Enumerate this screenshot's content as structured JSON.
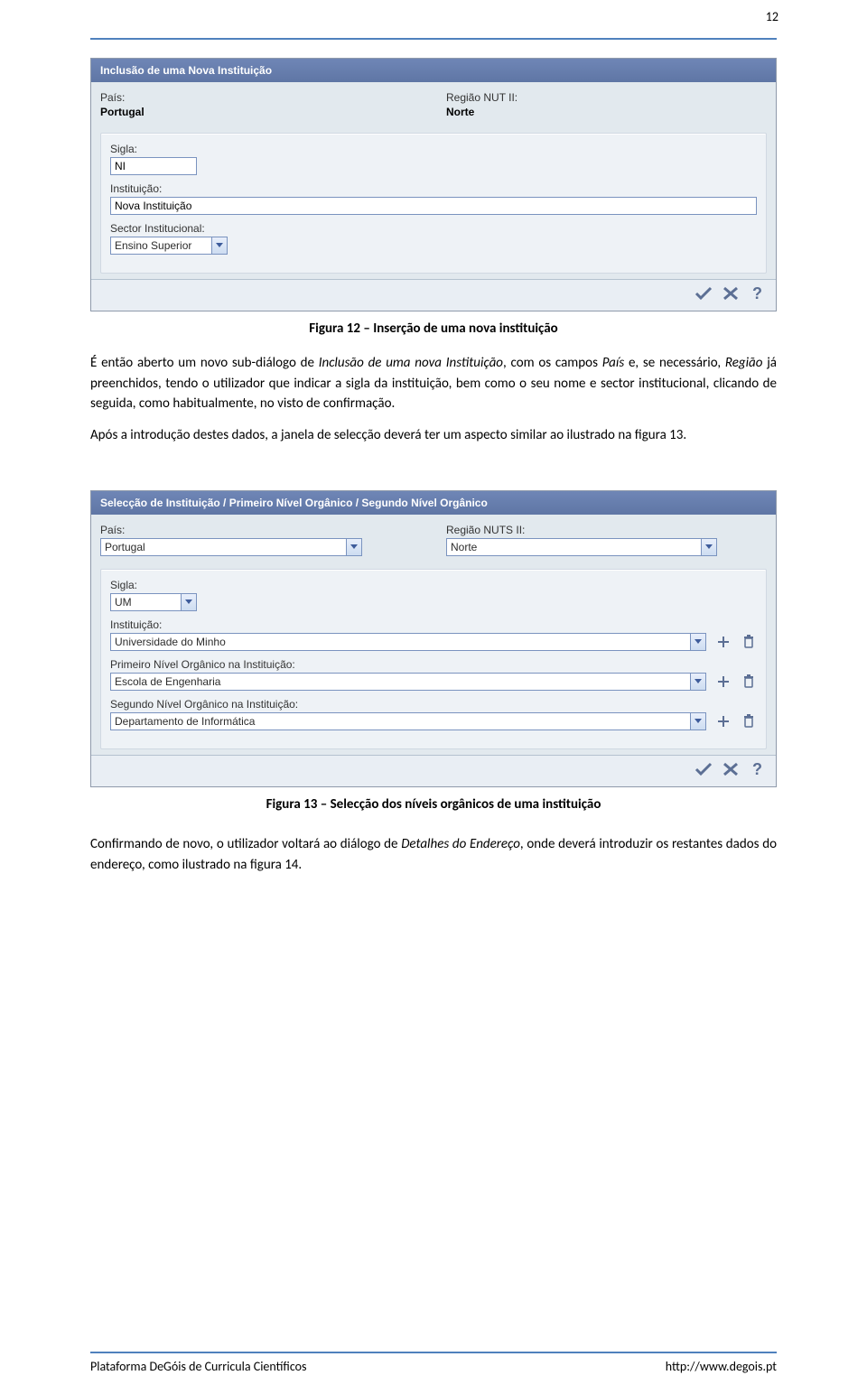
{
  "page_number": "12",
  "dialog1": {
    "title": "Inclusão de uma Nova Instituição",
    "pais_label": "País:",
    "pais_value": "Portugal",
    "regiao_label": "Região NUT II:",
    "regiao_value": "Norte",
    "sigla_label": "Sigla:",
    "sigla_value": "NI",
    "instituicao_label": "Instituição:",
    "instituicao_value": "Nova Instituição",
    "sector_label": "Sector Institucional:",
    "sector_value": "Ensino Superior"
  },
  "fig12_caption": "Figura 12 – Inserção de uma nova instituição",
  "para1_full": "É então aberto um novo sub-diálogo de Inclusão de uma nova Instituição, com os campos País e, se necessário, Região já preenchidos, tendo o utilizador que indicar a sigla da instituição, bem como o seu nome e sector institucional, clicando de seguida, como habitualmente, no visto de confirmação.",
  "para1_pieces": {
    "a": "É então aberto um novo sub-diálogo de ",
    "b_italic": "Inclusão de uma nova Instituição",
    "c": ", com os campos ",
    "d_italic": "País",
    "e": " e, se necessário, ",
    "f_italic": "Região",
    "g": " já preenchidos, tendo o utilizador que indicar a sigla da instituição, bem como o seu nome e sector institucional, clicando de seguida, como habitualmente, no visto de confirmação."
  },
  "para2": "Após a introdução destes dados, a janela de selecção deverá ter um aspecto similar ao ilustrado na figura 13.",
  "dialog2": {
    "title": "Selecção de Instituição / Primeiro Nível Orgânico / Segundo Nível Orgânico",
    "pais_label": "País:",
    "pais_value": "Portugal",
    "regiao_label": "Região NUTS II:",
    "regiao_value": "Norte",
    "sigla_label": "Sigla:",
    "sigla_value": "UM",
    "instituicao_label": "Instituição:",
    "instituicao_value": "Universidade do Minho",
    "primeiro_label": "Primeiro Nível Orgânico na Instituição:",
    "primeiro_value": "Escola de Engenharia",
    "segundo_label": "Segundo Nível Orgânico na Instituição:",
    "segundo_value": "Departamento de Informática"
  },
  "fig13_caption": "Figura 13 – Selecção dos níveis orgânicos de uma instituição",
  "para3_pieces": {
    "a": "Confirmando de novo, o utilizador voltará ao diálogo de ",
    "b_italic": "Detalhes do Endereço",
    "c": ", onde deverá introduzir os restantes dados do endereço, como ilustrado na figura 14."
  },
  "footer": {
    "left": "Plataforma DeGóis de Curricula Científicos",
    "right": "http://www.degois.pt"
  }
}
